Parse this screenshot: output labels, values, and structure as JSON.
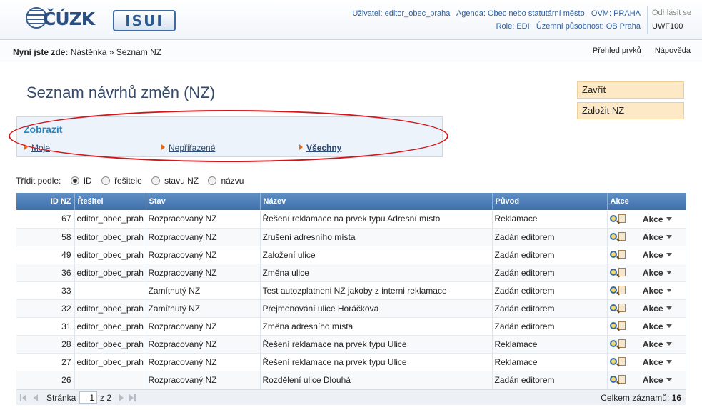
{
  "header": {
    "logo_cuzk": "ČÚZK",
    "logo_isui": "ISUI",
    "user_label": "Uživatel:",
    "user_value": "editor_obec_praha",
    "agenda_label": "Agenda:",
    "agenda_value": "Obec nebo statutární město",
    "ovm_label": "OVM:",
    "ovm_value": "PRAHA",
    "role_label": "Role:",
    "role_value": "EDI",
    "territory_label": "Územní působnost:",
    "territory_value": "OB Praha",
    "logout": "Odhlásit se",
    "user_code": "UWF100"
  },
  "breadcrumb": {
    "prefix": "Nyní jste zde:",
    "path": "Nástěnka » Seznam NZ"
  },
  "top_links": {
    "overview": "Přehled prvků",
    "help": "Nápověda"
  },
  "page_title": "Seznam návrhů změn (NZ)",
  "side_buttons": {
    "close": "Zavřít",
    "create": "Založit NZ"
  },
  "filter": {
    "title": "Zobrazit",
    "mine": "Moje",
    "unassigned": "Nepřiřazené",
    "all": "Všechny"
  },
  "sort": {
    "label": "Třídit podle:",
    "options": [
      "ID",
      "řešitele",
      "stavu NZ",
      "názvu"
    ],
    "selected": "ID"
  },
  "table": {
    "columns": [
      "ID NZ",
      "Řešitel",
      "Stav",
      "Název",
      "Původ",
      "Akce"
    ],
    "action_label": "Akce",
    "rows": [
      {
        "id": "67",
        "solver": "editor_obec_prah",
        "state": "Rozpracovaný NZ",
        "name": "Řešení reklamace na prvek typu Adresní místo",
        "origin": "Reklamace"
      },
      {
        "id": "58",
        "solver": "editor_obec_prah",
        "state": "Rozpracovaný NZ",
        "name": "Zrušení adresního místa",
        "origin": "Zadán editorem"
      },
      {
        "id": "49",
        "solver": "editor_obec_prah",
        "state": "Rozpracovaný NZ",
        "name": "Založení ulice",
        "origin": "Zadán editorem"
      },
      {
        "id": "36",
        "solver": "editor_obec_prah",
        "state": "Rozpracovaný NZ",
        "name": "Změna ulice",
        "origin": "Zadán editorem"
      },
      {
        "id": "33",
        "solver": "",
        "state": "Zamítnutý NZ",
        "name": "Test autozplatneni NZ jakoby z interni reklamace",
        "origin": "Zadán editorem"
      },
      {
        "id": "32",
        "solver": "editor_obec_prah",
        "state": "Zamítnutý NZ",
        "name": "Přejmenování ulice Horáčkova",
        "origin": "Zadán editorem"
      },
      {
        "id": "31",
        "solver": "editor_obec_prah",
        "state": "Rozpracovaný NZ",
        "name": "Změna adresního místa",
        "origin": "Zadán editorem"
      },
      {
        "id": "28",
        "solver": "editor_obec_prah",
        "state": "Rozpracovaný NZ",
        "name": "Řešení reklamace na prvek typu Ulice",
        "origin": "Reklamace"
      },
      {
        "id": "27",
        "solver": "editor_obec_prah",
        "state": "Rozpracovaný NZ",
        "name": "Řešení reklamace na prvek typu Ulice",
        "origin": "Reklamace"
      },
      {
        "id": "26",
        "solver": "",
        "state": "Rozpracovaný NZ",
        "name": "Rozdělení ulice Dlouhá",
        "origin": "Zadán editorem"
      }
    ]
  },
  "pager": {
    "page_label": "Stránka",
    "page_value": "1",
    "of_label": "z 2",
    "total_label": "Celkem záznamů:",
    "total_value": "16"
  },
  "colors": {
    "header_blue": "#2d5fa0",
    "grid_header": "#4a7ab4",
    "side_button_bg": "#fde9c6",
    "filter_panel_bg": "#ecf3fa",
    "highlight_ellipse": "#d4161c",
    "filter_arrow": "#e06a1a"
  }
}
